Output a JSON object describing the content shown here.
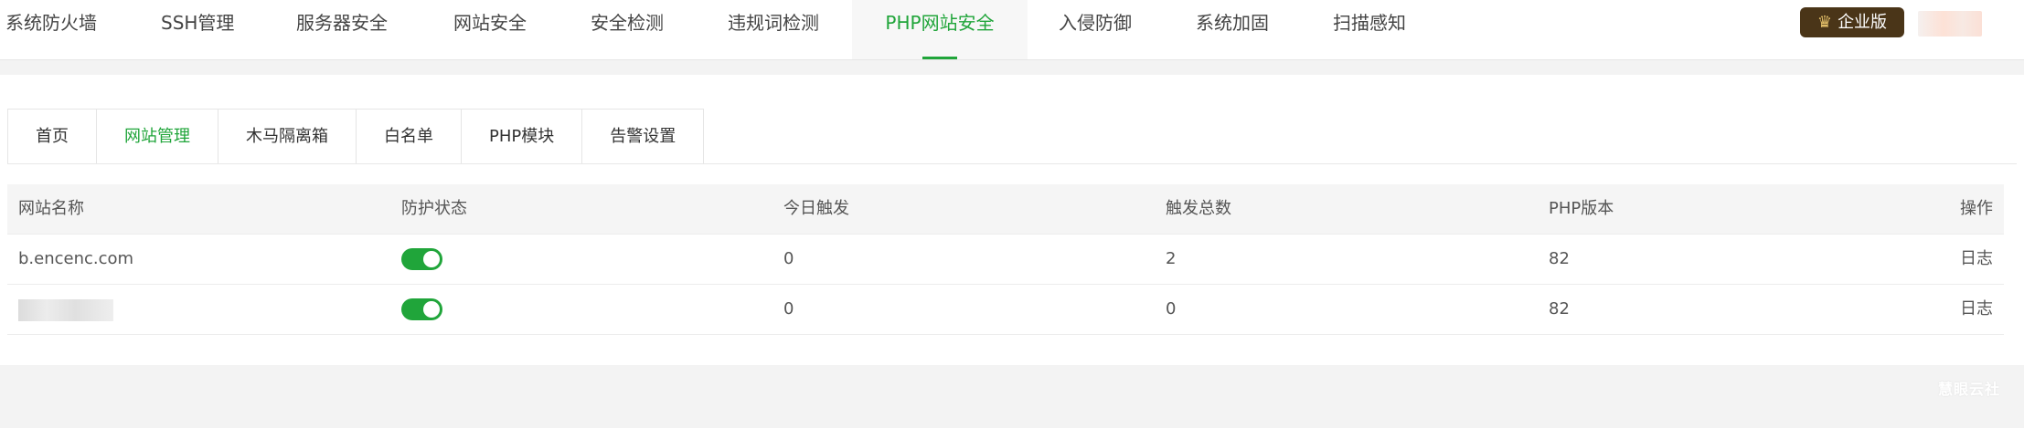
{
  "topnav": {
    "items": [
      {
        "label": "系统防火墙"
      },
      {
        "label": "SSH管理"
      },
      {
        "label": "服务器安全"
      },
      {
        "label": "网站安全"
      },
      {
        "label": "安全检测"
      },
      {
        "label": "违规词检测"
      },
      {
        "label": "PHP网站安全"
      },
      {
        "label": "入侵防御"
      },
      {
        "label": "系统加固"
      },
      {
        "label": "扫描感知"
      }
    ],
    "active_index": 6,
    "edition_badge": "企业版",
    "accent_color": "#20a53a"
  },
  "tabs": {
    "items": [
      {
        "label": "首页"
      },
      {
        "label": "网站管理"
      },
      {
        "label": "木马隔离箱"
      },
      {
        "label": "白名单"
      },
      {
        "label": "PHP模块"
      },
      {
        "label": "告警设置"
      }
    ],
    "active_index": 1
  },
  "table": {
    "columns": [
      "网站名称",
      "防护状态",
      "今日触发",
      "触发总数",
      "PHP版本",
      "操作"
    ],
    "rows": [
      {
        "name": "b.encenc.com",
        "protected": true,
        "today": "0",
        "total": "2",
        "php": "82",
        "action": "日志"
      },
      {
        "name": "",
        "protected": true,
        "today": "0",
        "total": "0",
        "php": "82",
        "action": "日志"
      }
    ]
  },
  "watermark": "慧眼云社"
}
